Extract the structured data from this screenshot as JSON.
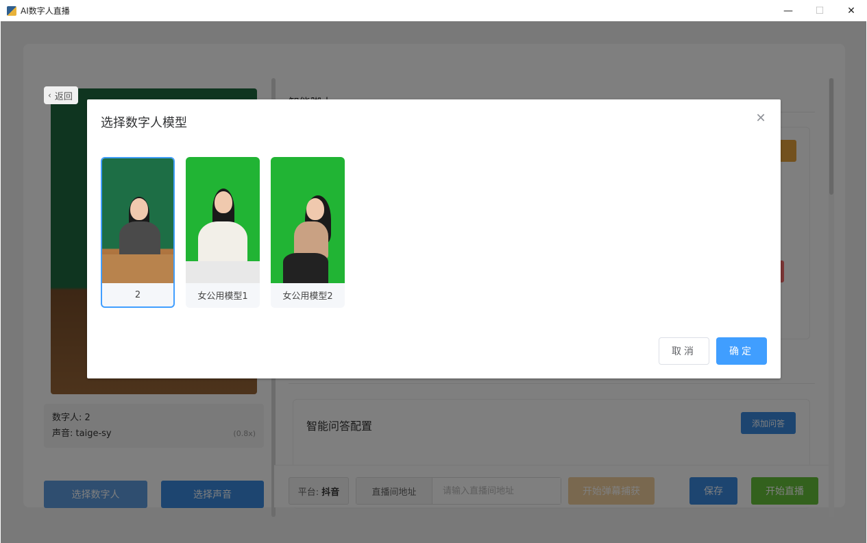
{
  "window": {
    "title": "AI数字人直播",
    "minimize": "—",
    "maximize": "☐",
    "close": "✕"
  },
  "left": {
    "back_label": "返回",
    "digital_human_label": "数字人:",
    "digital_human_value": "2",
    "voice_label": "声音:",
    "voice_value": "taige-sy",
    "voice_speed": "(0.8x)",
    "select_digital_human": "选择数字人",
    "select_voice": "选择声音"
  },
  "main": {
    "script_title": "智能脚本",
    "qa_title": "智能问答配置",
    "add_qa": "添加问答"
  },
  "bottom": {
    "platform_label": "平台:",
    "platform_value": "抖音",
    "url_label": "直播间地址",
    "url_placeholder": "请输入直播间地址",
    "start_capture": "开始弹幕捕获",
    "save": "保存",
    "start_live": "开始直播"
  },
  "dialog": {
    "title": "选择数字人模型",
    "models": [
      {
        "label": "2",
        "selected": true
      },
      {
        "label": "女公用模型1",
        "selected": false
      },
      {
        "label": "女公用模型2",
        "selected": false
      }
    ],
    "cancel": "取消",
    "confirm": "确定"
  },
  "colors": {
    "primary": "#409eff",
    "warning": "#e6a23c",
    "success": "#67c23a",
    "green_screen": "#21b434"
  }
}
